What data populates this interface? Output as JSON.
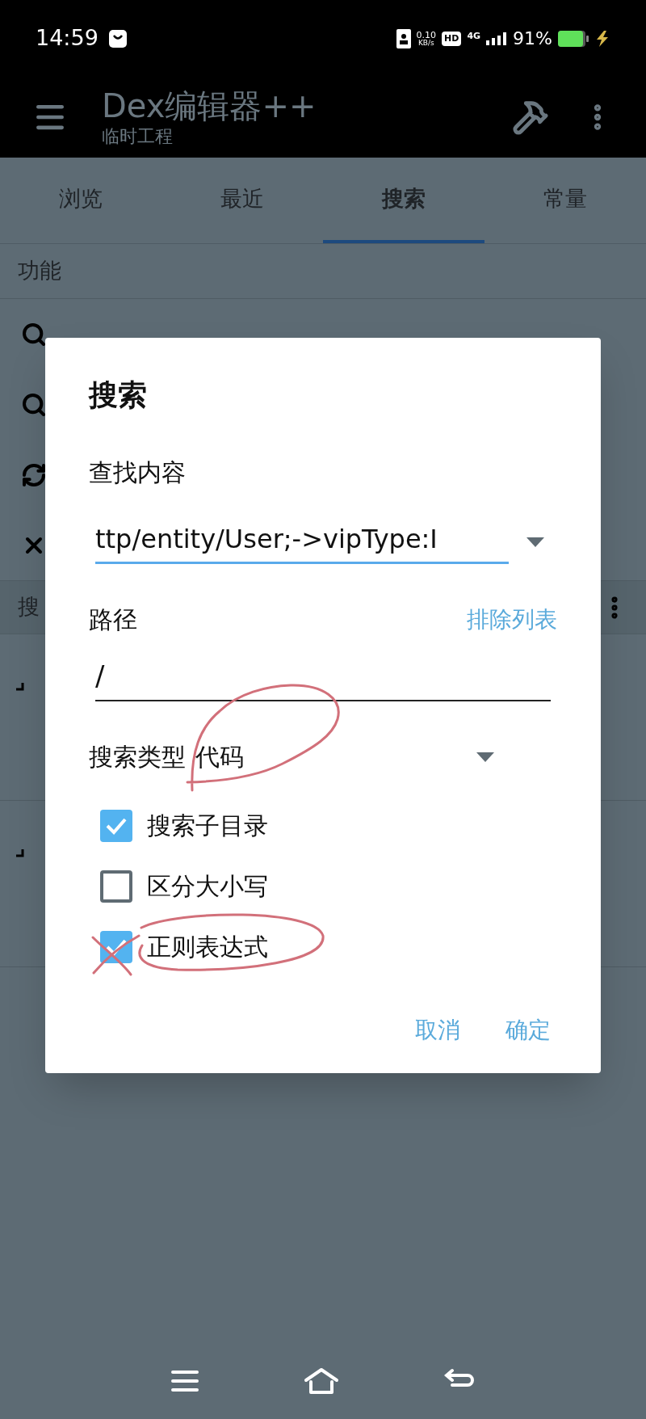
{
  "status_bar": {
    "time": "14:59",
    "speed_value": "0.10",
    "speed_unit": "KB/s",
    "hd_badge": "HD",
    "network_type": "4G",
    "battery": "91%"
  },
  "app_bar": {
    "title": "Dex编辑器++",
    "subtitle": "临时工程"
  },
  "tabs": [
    {
      "label": "浏览",
      "selected": false
    },
    {
      "label": "最近",
      "selected": false
    },
    {
      "label": "搜索",
      "selected": true
    },
    {
      "label": "常量",
      "selected": false
    }
  ],
  "functions": {
    "header": "功能",
    "items": [
      {
        "kind": "search"
      },
      {
        "kind": "search"
      },
      {
        "kind": "refresh"
      },
      {
        "kind": "close"
      }
    ]
  },
  "results": {
    "header": "搜"
  },
  "dialog": {
    "title": "搜索",
    "query_label": "查找内容",
    "query_value": "ttp/entity/User;->vipType:I",
    "path_label": "路径",
    "exclude_link": "排除列表",
    "path_value": "/",
    "type_label": "搜索类型",
    "type_value": "代码",
    "options": [
      {
        "label": "搜索子目录",
        "checked": true
      },
      {
        "label": "区分大小写",
        "checked": false
      },
      {
        "label": "正则表达式",
        "checked": true
      }
    ],
    "buttons": [
      "取消",
      "确定"
    ]
  }
}
